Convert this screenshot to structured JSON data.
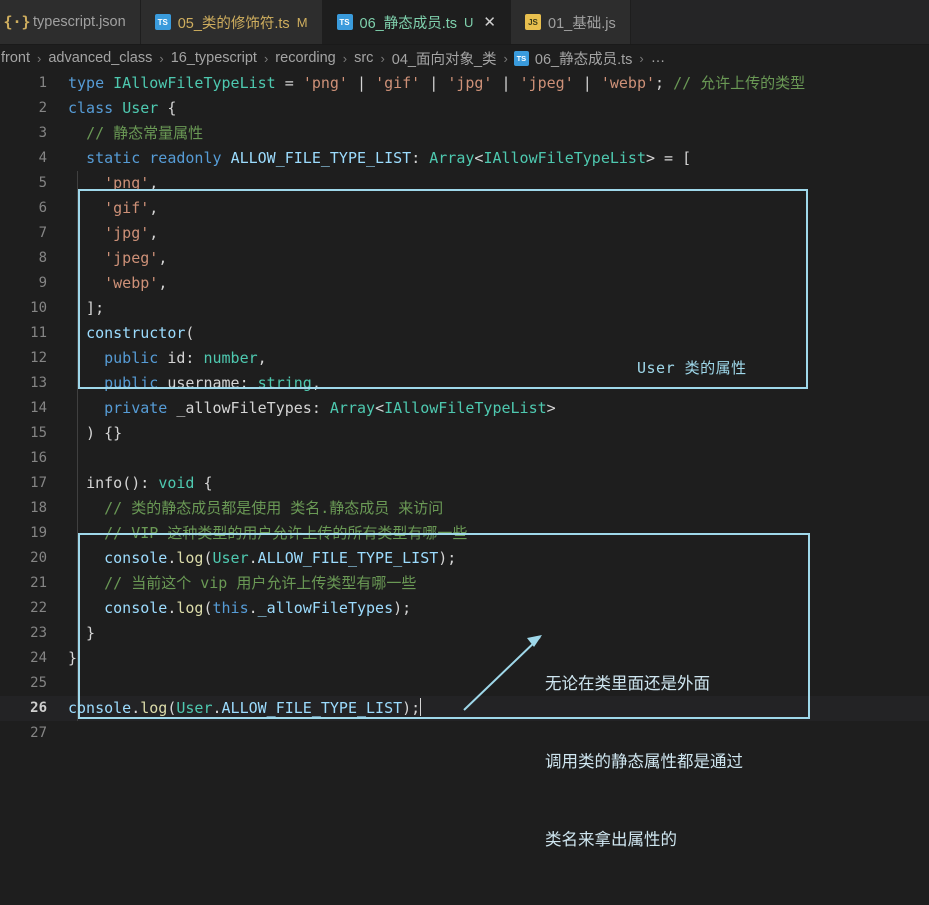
{
  "window": {
    "title": "06_静态成员.ts"
  },
  "tabbar": {
    "tabs": [
      {
        "icon": "json-icon",
        "icon_kind": "json",
        "label": "typescript.json",
        "badge": "",
        "active": false,
        "closeable": false,
        "label_style": "plain"
      },
      {
        "icon": "ts-file-icon",
        "icon_kind": "ts",
        "label": "05_类的修饰符.ts",
        "badge": "M",
        "active": false,
        "closeable": false,
        "label_style": "normal"
      },
      {
        "icon": "ts-file-icon",
        "icon_kind": "ts",
        "label": "06_静态成员.ts",
        "badge": "U",
        "active": true,
        "closeable": true,
        "close_glyph": "✕",
        "label_style": "normal"
      },
      {
        "icon": "js-file-icon",
        "icon_kind": "js",
        "label": "01_基础.js",
        "badge": "",
        "active": false,
        "closeable": false,
        "label_style": "plain"
      }
    ]
  },
  "breadcrumb": {
    "separator": "›",
    "items": [
      {
        "label": "front",
        "icon": null
      },
      {
        "label": "advanced_class",
        "icon": null
      },
      {
        "label": "16_typescript",
        "icon": null
      },
      {
        "label": "recording",
        "icon": null
      },
      {
        "label": "src",
        "icon": null
      },
      {
        "label": "04_面向对象_类",
        "icon": null
      },
      {
        "label": "06_静态成员.ts",
        "icon": "ts"
      },
      {
        "label": "…",
        "icon": null
      }
    ]
  },
  "editor": {
    "current_line": 26,
    "lines": [
      {
        "n": 1,
        "tokens": [
          {
            "t": "type ",
            "c": "kw"
          },
          {
            "t": "IAllowFileTypeList",
            "c": "typ"
          },
          {
            "t": " = ",
            "c": "op"
          },
          {
            "t": "'png'",
            "c": "str"
          },
          {
            "t": " | ",
            "c": "op"
          },
          {
            "t": "'gif'",
            "c": "str"
          },
          {
            "t": " | ",
            "c": "op"
          },
          {
            "t": "'jpg'",
            "c": "str"
          },
          {
            "t": " | ",
            "c": "op"
          },
          {
            "t": "'jpeg'",
            "c": "str"
          },
          {
            "t": " | ",
            "c": "op"
          },
          {
            "t": "'webp'",
            "c": "str"
          },
          {
            "t": "; ",
            "c": "op"
          },
          {
            "t": "// 允许上传的类型",
            "c": "cmt"
          }
        ]
      },
      {
        "n": 2,
        "tokens": [
          {
            "t": "class ",
            "c": "kw"
          },
          {
            "t": "User",
            "c": "typ"
          },
          {
            "t": " {",
            "c": "op"
          }
        ]
      },
      {
        "n": 3,
        "tokens": [
          {
            "t": "  ",
            "c": "op"
          },
          {
            "t": "// 静态常量属性",
            "c": "cmt"
          }
        ]
      },
      {
        "n": 4,
        "tokens": [
          {
            "t": "  ",
            "c": "op"
          },
          {
            "t": "static ",
            "c": "kw"
          },
          {
            "t": "readonly ",
            "c": "kw"
          },
          {
            "t": "ALLOW_FILE_TYPE_LIST",
            "c": "var"
          },
          {
            "t": ": ",
            "c": "op"
          },
          {
            "t": "Array",
            "c": "typ"
          },
          {
            "t": "<",
            "c": "op"
          },
          {
            "t": "IAllowFileTypeList",
            "c": "typ"
          },
          {
            "t": "> = [",
            "c": "op"
          }
        ]
      },
      {
        "n": 5,
        "tokens": [
          {
            "t": "    ",
            "c": "op"
          },
          {
            "t": "'png'",
            "c": "str"
          },
          {
            "t": ",",
            "c": "op"
          }
        ]
      },
      {
        "n": 6,
        "tokens": [
          {
            "t": "    ",
            "c": "op"
          },
          {
            "t": "'gif'",
            "c": "str"
          },
          {
            "t": ",",
            "c": "op"
          }
        ]
      },
      {
        "n": 7,
        "tokens": [
          {
            "t": "    ",
            "c": "op"
          },
          {
            "t": "'jpg'",
            "c": "str"
          },
          {
            "t": ",",
            "c": "op"
          }
        ]
      },
      {
        "n": 8,
        "tokens": [
          {
            "t": "    ",
            "c": "op"
          },
          {
            "t": "'jpeg'",
            "c": "str"
          },
          {
            "t": ",",
            "c": "op"
          }
        ]
      },
      {
        "n": 9,
        "tokens": [
          {
            "t": "    ",
            "c": "op"
          },
          {
            "t": "'webp'",
            "c": "str"
          },
          {
            "t": ",",
            "c": "op"
          }
        ]
      },
      {
        "n": 10,
        "tokens": [
          {
            "t": "  ];",
            "c": "op"
          }
        ]
      },
      {
        "n": 11,
        "tokens": [
          {
            "t": "  ",
            "c": "op"
          },
          {
            "t": "constructor",
            "c": "var"
          },
          {
            "t": "(",
            "c": "op"
          }
        ]
      },
      {
        "n": 12,
        "tokens": [
          {
            "t": "    ",
            "c": "op"
          },
          {
            "t": "public ",
            "c": "kw"
          },
          {
            "t": "id",
            "c": "pl"
          },
          {
            "t": ": ",
            "c": "op"
          },
          {
            "t": "number",
            "c": "typ"
          },
          {
            "t": ",",
            "c": "op"
          }
        ]
      },
      {
        "n": 13,
        "tokens": [
          {
            "t": "    ",
            "c": "op"
          },
          {
            "t": "public ",
            "c": "kw"
          },
          {
            "t": "username",
            "c": "pl"
          },
          {
            "t": ": ",
            "c": "op"
          },
          {
            "t": "string",
            "c": "typ"
          },
          {
            "t": ",",
            "c": "op"
          }
        ]
      },
      {
        "n": 14,
        "tokens": [
          {
            "t": "    ",
            "c": "op"
          },
          {
            "t": "private ",
            "c": "kw"
          },
          {
            "t": "_allowFileTypes",
            "c": "pl"
          },
          {
            "t": ": ",
            "c": "op"
          },
          {
            "t": "Array",
            "c": "typ"
          },
          {
            "t": "<",
            "c": "op"
          },
          {
            "t": "IAllowFileTypeList",
            "c": "typ"
          },
          {
            "t": ">",
            "c": "op"
          }
        ]
      },
      {
        "n": 15,
        "tokens": [
          {
            "t": "  ) {}",
            "c": "op"
          }
        ]
      },
      {
        "n": 16,
        "tokens": []
      },
      {
        "n": 17,
        "tokens": [
          {
            "t": "  ",
            "c": "op"
          },
          {
            "t": "info",
            "c": "pl"
          },
          {
            "t": "(): ",
            "c": "op"
          },
          {
            "t": "void",
            "c": "typ"
          },
          {
            "t": " {",
            "c": "op"
          }
        ]
      },
      {
        "n": 18,
        "tokens": [
          {
            "t": "    ",
            "c": "op"
          },
          {
            "t": "// 类的静态成员都是使用 类名.静态成员 来访问",
            "c": "cmt"
          }
        ]
      },
      {
        "n": 19,
        "tokens": [
          {
            "t": "    ",
            "c": "op"
          },
          {
            "t": "// VIP 这种类型的用户允许上传的所有类型有哪一些",
            "c": "cmt"
          }
        ]
      },
      {
        "n": 20,
        "tokens": [
          {
            "t": "    ",
            "c": "op"
          },
          {
            "t": "console",
            "c": "var"
          },
          {
            "t": ".",
            "c": "op"
          },
          {
            "t": "log",
            "c": "fn"
          },
          {
            "t": "(",
            "c": "op"
          },
          {
            "t": "User",
            "c": "typ"
          },
          {
            "t": ".",
            "c": "op"
          },
          {
            "t": "ALLOW_FILE_TYPE_LIST",
            "c": "var"
          },
          {
            "t": ");",
            "c": "op"
          }
        ]
      },
      {
        "n": 21,
        "tokens": [
          {
            "t": "    ",
            "c": "op"
          },
          {
            "t": "// 当前这个 vip 用户允许上传类型有哪一些",
            "c": "cmt"
          }
        ]
      },
      {
        "n": 22,
        "tokens": [
          {
            "t": "    ",
            "c": "op"
          },
          {
            "t": "console",
            "c": "var"
          },
          {
            "t": ".",
            "c": "op"
          },
          {
            "t": "log",
            "c": "fn"
          },
          {
            "t": "(",
            "c": "op"
          },
          {
            "t": "this",
            "c": "kw"
          },
          {
            "t": ".",
            "c": "op"
          },
          {
            "t": "_allowFileTypes",
            "c": "var"
          },
          {
            "t": ");",
            "c": "op"
          }
        ]
      },
      {
        "n": 23,
        "tokens": [
          {
            "t": "  }",
            "c": "op"
          }
        ]
      },
      {
        "n": 24,
        "tokens": [
          {
            "t": "}",
            "c": "op"
          }
        ]
      },
      {
        "n": 25,
        "tokens": []
      },
      {
        "n": 26,
        "tokens": [
          {
            "t": "console",
            "c": "var"
          },
          {
            "t": ".",
            "c": "op"
          },
          {
            "t": "log",
            "c": "fn"
          },
          {
            "t": "(",
            "c": "op"
          },
          {
            "t": "User",
            "c": "typ"
          },
          {
            "t": ".",
            "c": "op"
          },
          {
            "t": "ALLOW_FILE_TYPE_LIST",
            "c": "var"
          },
          {
            "t": ");",
            "c": "op"
          }
        ]
      },
      {
        "n": 27,
        "tokens": []
      }
    ]
  },
  "annotations": {
    "box1_label": "User 类的属性",
    "box2_text_lines": [
      "无论在类里面还是外面",
      "调用类的静态属性都是通过",
      "类名来拿出属性的"
    ],
    "accent_color": "#9fd8ea"
  }
}
